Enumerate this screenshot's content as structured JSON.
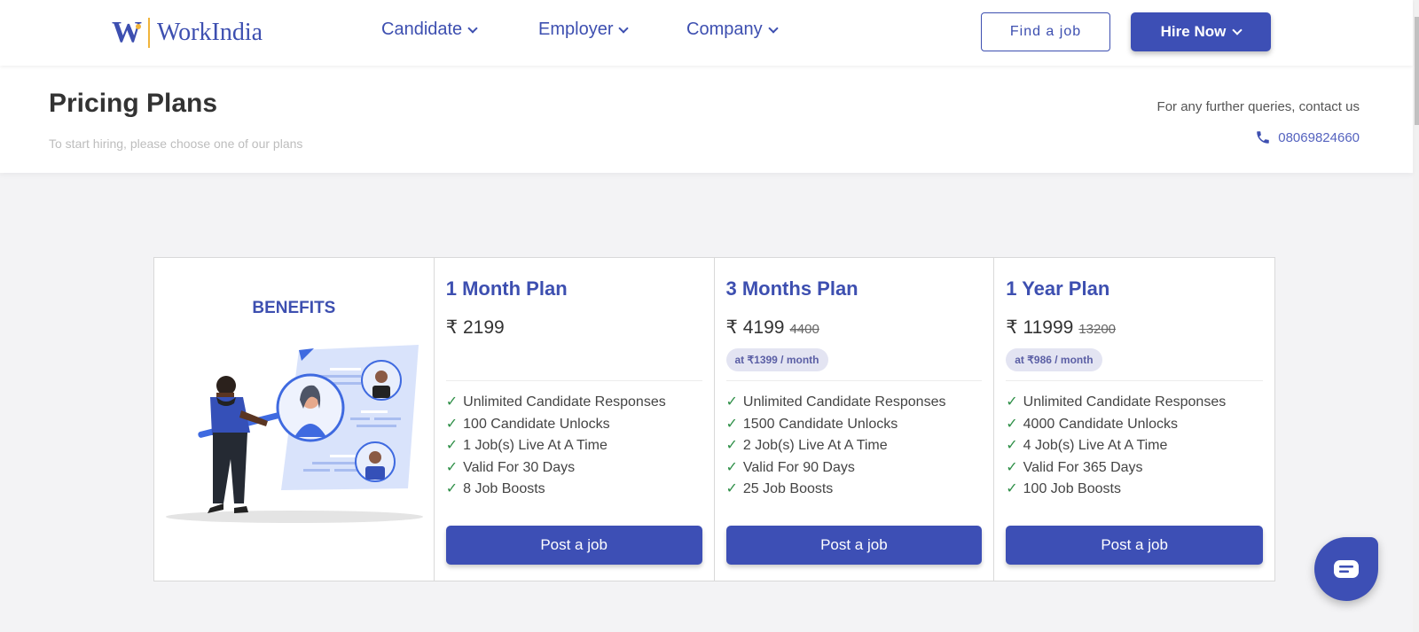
{
  "header": {
    "logo_mark": "W",
    "logo_text": "WorkIndia",
    "nav": [
      {
        "label": "Candidate"
      },
      {
        "label": "Employer"
      },
      {
        "label": "Company"
      }
    ],
    "find_job_label": "Find a job",
    "hire_now_label": "Hire Now"
  },
  "page": {
    "title": "Pricing Plans",
    "subtitle": "To start hiring, please choose one of our plans",
    "contact_label": "For any further queries, contact us",
    "contact_phone": "08069824660"
  },
  "benefits": {
    "title": "BENEFITS"
  },
  "plans": [
    {
      "name": "1 Month Plan",
      "currency": "₹",
      "price": "2199",
      "old_price": "",
      "per_month": "",
      "features": [
        "Unlimited Candidate Responses",
        "100 Candidate Unlocks",
        "1 Job(s) Live At A Time",
        "Valid For 30 Days",
        "8 Job Boosts"
      ],
      "cta": "Post a job"
    },
    {
      "name": "3 Months Plan",
      "currency": "₹",
      "price": "4199",
      "old_price": "4400",
      "per_month": "at ₹1399 / month",
      "features": [
        "Unlimited Candidate Responses",
        "1500 Candidate Unlocks",
        "2 Job(s) Live At A Time",
        "Valid For 90 Days",
        "25 Job Boosts"
      ],
      "cta": "Post a job"
    },
    {
      "name": "1 Year Plan",
      "currency": "₹",
      "price": "11999",
      "old_price": "13200",
      "per_month": "at ₹986 / month",
      "features": [
        "Unlimited Candidate Responses",
        "4000 Candidate Unlocks",
        "4 Job(s) Live At A Time",
        "Valid For 365 Days",
        "100 Job Boosts"
      ],
      "cta": "Post a job"
    }
  ],
  "feature_tick": "✓",
  "colors": {
    "brand": "#3d4fb5",
    "tick": "#2e8f47",
    "logo_accent": "#f1b43b"
  }
}
